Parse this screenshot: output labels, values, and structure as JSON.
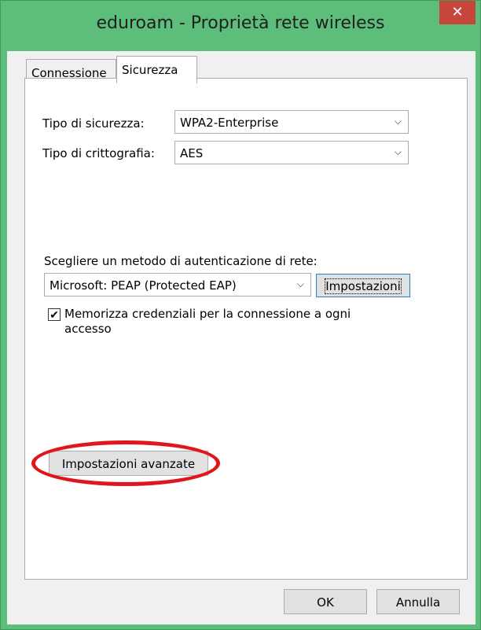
{
  "window": {
    "title": "eduroam - Proprietà rete wireless",
    "close_glyph": "✕",
    "titlebar_color": "#5cbe7a",
    "close_color": "#c7463b"
  },
  "tabs": [
    {
      "label": "Connessione",
      "active": false
    },
    {
      "label": "Sicurezza",
      "active": true
    }
  ],
  "security": {
    "type_label": "Tipo di sicurezza:",
    "type_value": "WPA2-Enterprise",
    "encryption_label": "Tipo di crittografia:",
    "encryption_value": "AES",
    "auth_method_label": "Scegliere un metodo di autenticazione di rete:",
    "auth_method_value": "Microsoft: PEAP (Protected EAP)",
    "settings_button": "Impostazioni",
    "remember_checked": true,
    "remember_line1": "Memorizza credenziali per la connessione a ogni",
    "remember_line2": "accesso",
    "advanced_button": "Impostazioni avanzate"
  },
  "footer": {
    "ok": "OK",
    "cancel": "Annulla"
  },
  "annotation": {
    "color": "#e0161c"
  }
}
